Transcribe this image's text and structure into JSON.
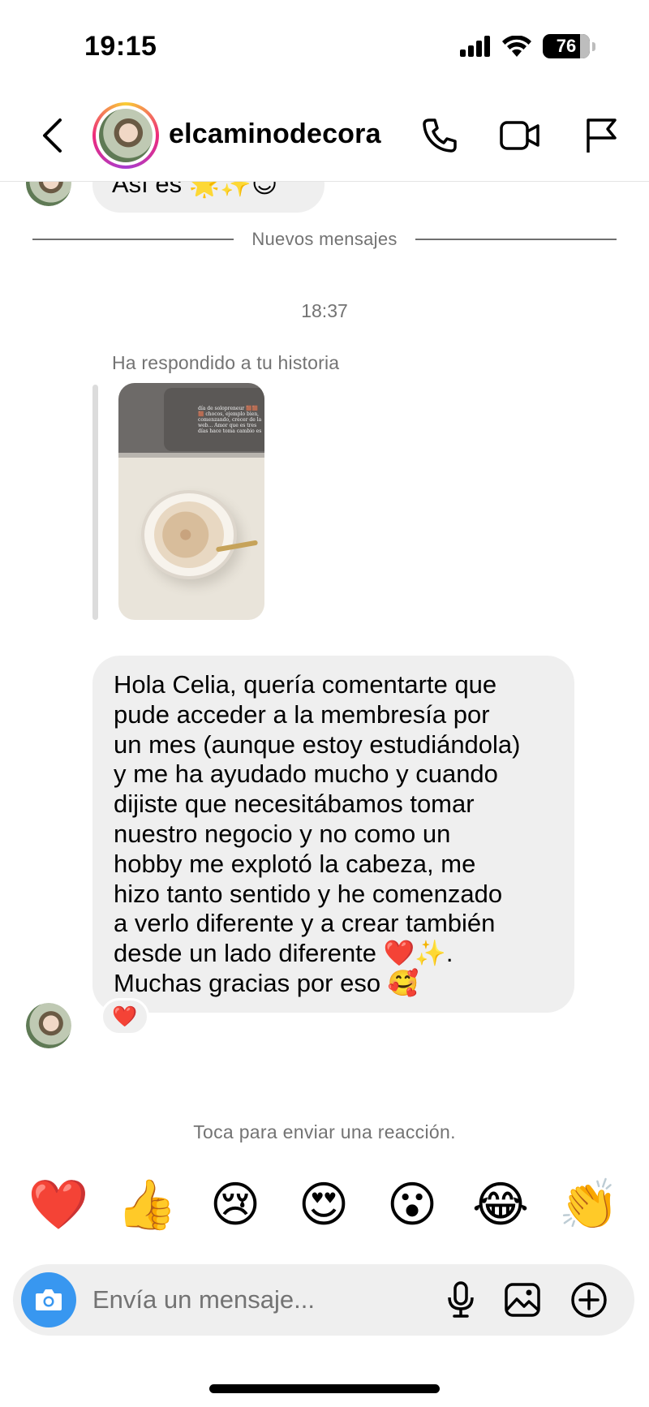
{
  "status_bar": {
    "time": "19:15",
    "battery": "76",
    "icons": [
      "signal-icon",
      "wifi-icon",
      "battery-icon"
    ]
  },
  "header": {
    "username": "elcaminodecora",
    "icons": [
      "back-chevron-icon",
      "phone-icon",
      "video-camera-icon",
      "flag-icon"
    ],
    "story_ring_colors": [
      "#f9ce34",
      "#ee2a7b",
      "#a63ccf"
    ]
  },
  "thread": {
    "previous_message": "Así es 🌟✨😊",
    "new_messages_divider": "Nuevos mensajes",
    "timestamp": "18:37",
    "story_reply_label": "Ha respondido a tu historia",
    "story_thumb_text": "día de solopreneur 🟫🟫🟫 chocos, ejemplo bien, comenzando, crecer de la web... Amor que es tres días hace toma cambio es",
    "message": "Hola Celia, quería comentarte que\npude acceder a la membresía por\nun mes (aunque estoy estudiándola)\ny me ha ayudado mucho y cuando\ndijiste que necesitábamos tomar\nnuestro negocio y no como un\nhobby me explotó la cabeza, me\nhizo tanto sentido y he comenzado\na verlo diferente y a crear también\ndesde un lado diferente ❤️✨.\nMuchas gracias por eso 🥰",
    "message_reaction": "❤️",
    "reaction_hint": "Toca para enviar una reacción."
  },
  "quick_reactions": [
    "❤️",
    "👍",
    "😢",
    "😍",
    "😮",
    "😂",
    "👏"
  ],
  "composer": {
    "placeholder": "Envía un mensaje...",
    "icons": [
      "camera-icon",
      "microphone-icon",
      "image-icon",
      "plus-circle-icon"
    ],
    "camera_color": "#3897f0"
  }
}
